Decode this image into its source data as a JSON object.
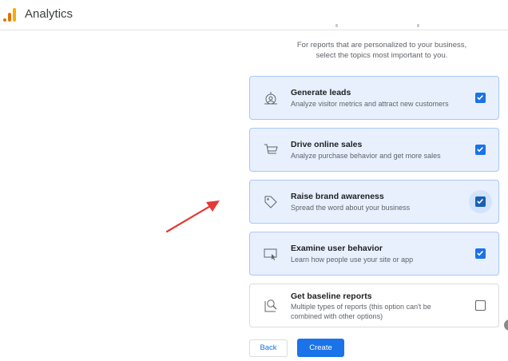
{
  "app": {
    "title": "Analytics"
  },
  "intro": {
    "line1": "For reports that are personalized to your business,",
    "line2": "select the topics most important to you."
  },
  "options": [
    {
      "title": "Generate leads",
      "description": "Analyze visitor metrics and attract new customers",
      "checked": true,
      "icon": "target-person-icon"
    },
    {
      "title": "Drive online sales",
      "description": "Analyze purchase behavior and get more sales",
      "checked": true,
      "icon": "shopping-cart-icon"
    },
    {
      "title": "Raise brand awareness",
      "description": "Spread the word about your business",
      "checked": true,
      "icon": "tag-icon"
    },
    {
      "title": "Examine user behavior",
      "description": "Learn how people use your site or app",
      "checked": true,
      "icon": "screen-cursor-icon"
    },
    {
      "title": "Get baseline reports",
      "description": "Multiple types of reports (this option can't be combined with other options)",
      "checked": false,
      "icon": "magnifier-chart-icon"
    }
  ],
  "actions": {
    "back_label": "Back",
    "create_label": "Create"
  },
  "colors": {
    "accent": "#1a73e8",
    "selected_bg": "#e8f0fe",
    "annotation_arrow": "#e53935"
  }
}
